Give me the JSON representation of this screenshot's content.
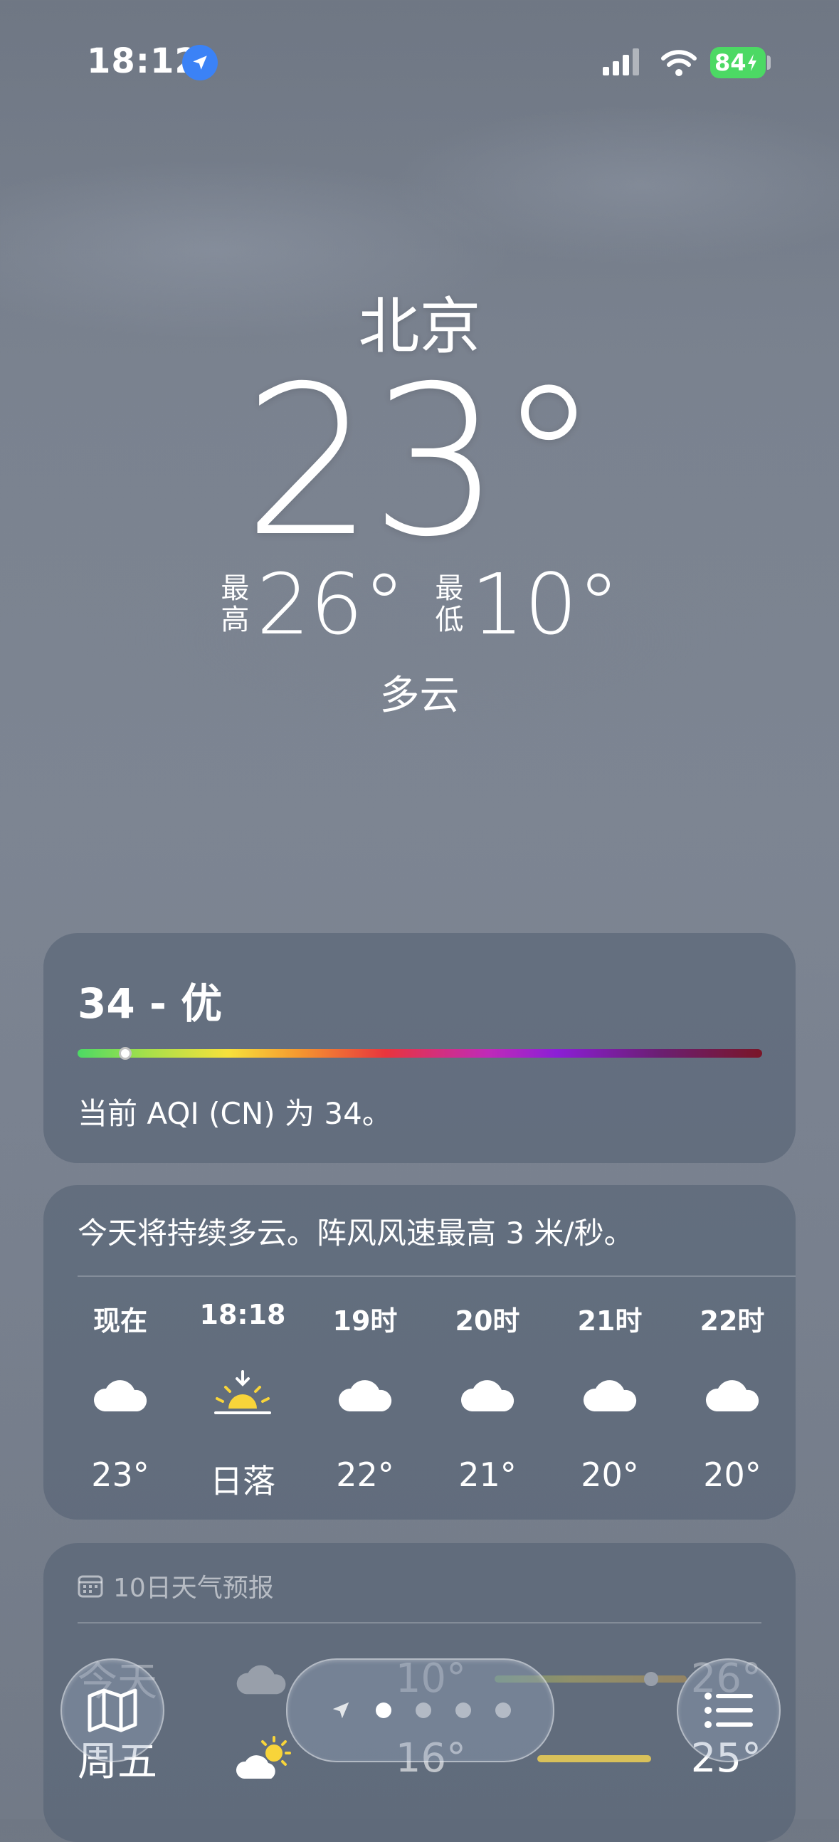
{
  "status_bar": {
    "time": "18:12",
    "battery": "84"
  },
  "hero": {
    "city": "北京",
    "temperature": "23°",
    "high_label": "最高",
    "high": "26°",
    "low_label": "最低",
    "low": "10°",
    "condition": "多云"
  },
  "aqi": {
    "title": "34 - 优",
    "level_fraction": 0.07,
    "description": "当前 AQI (CN) 为 34。"
  },
  "hourly": {
    "summary": "今天将持续多云。阵风风速最高 3 米/秒。",
    "items": [
      {
        "time": "现在",
        "icon": "cloud-icon",
        "value": "23°"
      },
      {
        "time": "18:18",
        "icon": "sunset-icon",
        "value": "日落"
      },
      {
        "time": "19时",
        "icon": "cloud-icon",
        "value": "22°"
      },
      {
        "time": "20时",
        "icon": "cloud-icon",
        "value": "21°"
      },
      {
        "time": "21时",
        "icon": "cloud-icon",
        "value": "20°"
      },
      {
        "time": "22时",
        "icon": "cloud-icon",
        "value": "20°"
      }
    ]
  },
  "forecast": {
    "title": "10日天气预报",
    "rows": [
      {
        "day": "今天",
        "icon": "cloud-icon",
        "low": "10°",
        "high": "26°"
      },
      {
        "day": "周五",
        "icon": "partly-sunny-icon",
        "low": "16°",
        "high": "25°"
      }
    ]
  },
  "pager": {
    "page_count": 4,
    "active_index": 0
  }
}
